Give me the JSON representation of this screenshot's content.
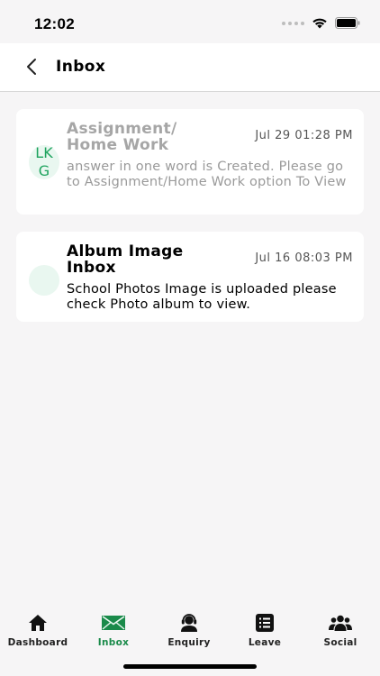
{
  "status_bar": {
    "time": "12:02"
  },
  "header": {
    "title": "Inbox"
  },
  "messages": [
    {
      "avatar_text": "LKG",
      "title": "Assignment/ Home Work",
      "date": "Jul 29 01:28 PM",
      "body": "answer in one word is Created. Please go to Assignment/Home Work option To View",
      "read": true
    },
    {
      "avatar_text": "",
      "title": "Album Image Inbox",
      "date": "Jul 16 08:03 PM",
      "body": "School Photos Image is uploaded please check Photo album to view.",
      "read": false
    }
  ],
  "tabs": [
    {
      "label": "Dashboard",
      "icon": "home-icon"
    },
    {
      "label": "Inbox",
      "icon": "envelope-icon",
      "active": true
    },
    {
      "label": "Enquiry",
      "icon": "support-agent-icon"
    },
    {
      "label": "Leave",
      "icon": "list-icon"
    },
    {
      "label": "Social",
      "icon": "group-icon"
    }
  ],
  "colors": {
    "accent": "#1a8a4a",
    "avatar_bg": "#e9f7f0",
    "background": "#f6f5f6"
  }
}
